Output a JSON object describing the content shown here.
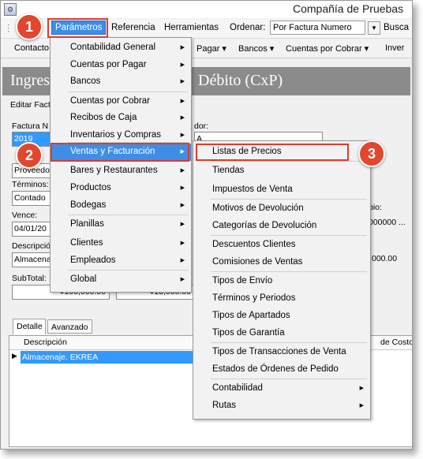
{
  "window": {
    "title": "Compañía de Pruebas",
    "icon": "app-icon"
  },
  "menubar": {
    "items": [
      "Parámetros",
      "Referencia",
      "Herramientas",
      "Ordenar:"
    ],
    "ordenar_value": "Por Factura Numero",
    "search_label": "Busca"
  },
  "toolbar": {
    "items": [
      "Contacto",
      "Pagar",
      "Bancos",
      "Cuentas por Cobrar",
      "Inver"
    ]
  },
  "header": {
    "left": "Ingres",
    "right": "Débito (CxP)"
  },
  "form": {
    "editar_label": "Editar Factu",
    "factura_label": "Factura N",
    "factura_value": "2019",
    "dor_label": "dor:",
    "proveedor_value": "Proveedo",
    "terminos_label": "Términos:",
    "terminos_value": "Contado",
    "vence_label": "Vence:",
    "vence_value": "04/01/20",
    "descripcion_label": "Descripció",
    "descripcion_value": "Almacenaj",
    "subtotal_label": "SubTotal:",
    "subtotal_value": "¢100,000.00",
    "second_amount": "¢13,000.00",
    "bio_label": "bio:",
    "rate_value": "000000 ...",
    "amount_right": "000.00",
    "a_value": "A"
  },
  "tabs": [
    "Detalle",
    "Avanzado"
  ],
  "grid": {
    "col_descripcion": "Descripción",
    "col_costo": "de Costo",
    "row1": "Almacenaje. EKREA"
  },
  "menu_parametros": [
    {
      "label": "Contabilidad General",
      "arrow": true
    },
    {
      "label": "Cuentas por Pagar",
      "arrow": true
    },
    {
      "label": "Bancos",
      "arrow": true
    },
    {
      "label": "Cuentas por Cobrar",
      "arrow": true
    },
    {
      "label": "Recibos de Caja",
      "arrow": true
    },
    {
      "label": "Inventarios y Compras",
      "arrow": true
    },
    {
      "label": "Ventas y Facturación",
      "arrow": true,
      "highlight": true
    },
    {
      "label": "Bares y Restaurantes",
      "arrow": true
    },
    {
      "label": "Productos",
      "arrow": true
    },
    {
      "label": "Bodegas",
      "arrow": true
    },
    {
      "label": "Planillas",
      "arrow": true
    },
    {
      "label": "Clientes",
      "arrow": true
    },
    {
      "label": "Empleados",
      "arrow": true
    },
    {
      "label": "Global",
      "arrow": true
    }
  ],
  "menu_ventas": [
    {
      "label": "Listas de Precios"
    },
    {
      "label": "Tiendas"
    },
    {
      "label": "Impuestos de Venta"
    },
    {
      "label": "Motivos de Devolución"
    },
    {
      "label": "Categorías de Devolución"
    },
    {
      "label": "Descuentos Clientes"
    },
    {
      "label": "Comisiones de Ventas"
    },
    {
      "label": "Tipos de Envío"
    },
    {
      "label": "Términos y Periodos"
    },
    {
      "label": "Tipos de Apartados"
    },
    {
      "label": "Tipos de Garantía"
    },
    {
      "label": "Tipos de Transacciones de Venta"
    },
    {
      "label": "Estados de Órdenes de Pedido"
    },
    {
      "label": "Contabilidad",
      "arrow": true
    },
    {
      "label": "Rutas",
      "arrow": true
    }
  ],
  "badges": [
    "1",
    "2",
    "3"
  ],
  "colors": {
    "highlight": "#3d8ee6",
    "annotation": "#e2462c",
    "header_band": "#8b8b8b"
  }
}
